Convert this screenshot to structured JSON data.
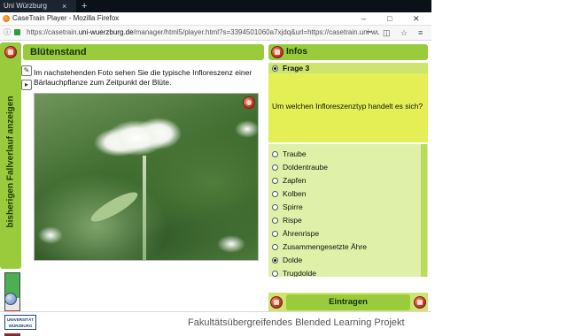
{
  "browser": {
    "tab_label": "Uni Würzburg",
    "tab_close": "×",
    "new_tab": "+",
    "window_title": "CaseTrain Player - Mozilla Firefox",
    "url_prefix": "https://casetrain.",
    "url_domain": "uni-wuerzburg.de",
    "url_rest": "/manager/html5/player.html?s=3394501060a7xjdq&url=https://casetrain.uni-wuerzburg.de/manag...",
    "controls": {
      "minimize": "–",
      "maximize": "□",
      "close": "✕"
    },
    "icons": {
      "info": "ⓘ",
      "lock": "🔒",
      "more": "•••",
      "pocket": "◫",
      "bookmark": "☆",
      "menu": "≡"
    }
  },
  "sidebar": {
    "label": "bisherigen Fallverlauf anzeigen"
  },
  "card": {
    "title": "Blütenstand",
    "description": "Im nachstehenden Foto sehen Sie die typische Infloreszenz einer Bärlauchpflanze zum Zeitpunkt der Blüte."
  },
  "info_panel": {
    "title": "Infos",
    "question_label": "Frage 3",
    "question_text": "Um welchen Infloreszenztyp handelt es sich?",
    "options": [
      {
        "label": "Traube",
        "selected": false
      },
      {
        "label": "Doldentraube",
        "selected": false
      },
      {
        "label": "Zapfen",
        "selected": false
      },
      {
        "label": "Kolben",
        "selected": false
      },
      {
        "label": "Spirre",
        "selected": false
      },
      {
        "label": "Rispe",
        "selected": false
      },
      {
        "label": "Ährenrispe",
        "selected": false
      },
      {
        "label": "Zusammengesetzte Ähre",
        "selected": false
      },
      {
        "label": "Dolde",
        "selected": true
      },
      {
        "label": "Trugdolde",
        "selected": false
      }
    ],
    "submit_label": "Eintragen"
  },
  "footer": {
    "logo_line1": "UNIVERSITÄT",
    "logo_line2": "WÜRZBURG",
    "project": "Fakultätsübergreifendes Blended Learning Projekt"
  },
  "colors": {
    "accent_green": "#9acb3c",
    "question_yellow": "#e3ef55",
    "options_bg": "#dff0a8",
    "button_red": "#c0392b"
  }
}
